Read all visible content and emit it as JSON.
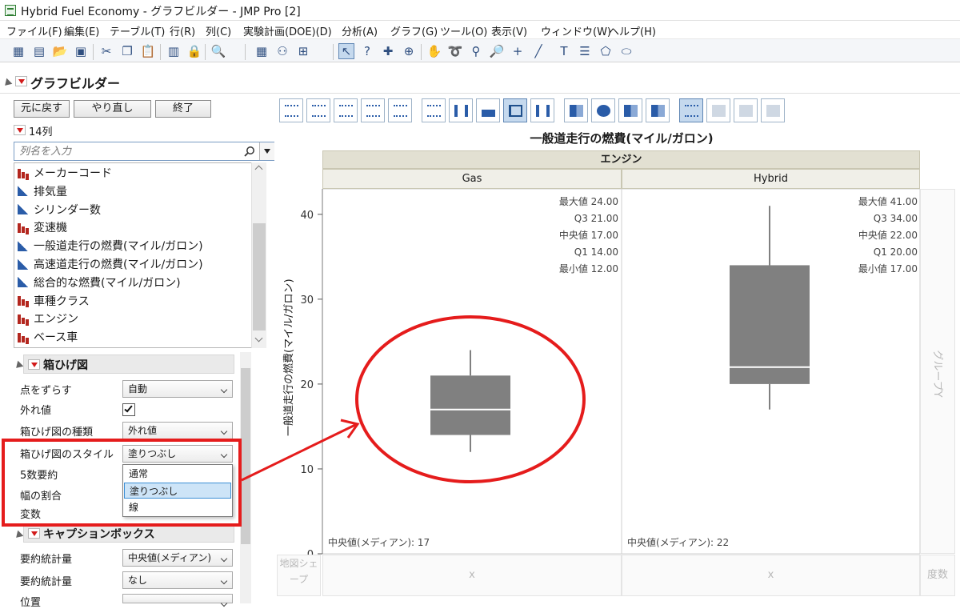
{
  "window": {
    "title": "Hybrid Fuel Economy - グラフビルダー - JMP Pro [2]"
  },
  "menu": [
    "ファイル(F)",
    "編集(E)",
    "テーブル(T)",
    "行(R)",
    "列(C)",
    "実験計画(DOE)(D)",
    "分析(A)",
    "グラフ(G)",
    "ツール(O)",
    "表示(V)",
    "ウィンドウ(W)",
    "ヘルプ(H)"
  ],
  "toolbar_icons": [
    "new-data-table-icon",
    "new-script-icon",
    "open-icon",
    "save-icon",
    "cut-icon",
    "copy-icon",
    "paste-icon",
    "journal-icon",
    "lock-icon",
    "search-icon",
    "data-grid-icon",
    "binoculars-icon",
    "add-column-icon",
    "arrow-tool-icon",
    "help-tool-icon",
    "selection-tool-icon",
    "crosshair-tool-icon",
    "grabber-tool-icon",
    "lasso-tool-icon",
    "brush-tool-icon",
    "zoom-tool-icon",
    "plus-tool-icon",
    "line-tool-icon",
    "annotate-tool-icon",
    "list-tool-icon",
    "polygon-tool-icon",
    "ellipse-tool-icon"
  ],
  "header": {
    "title": "グラフビルダー",
    "undo_label": "元に戻す",
    "redo_label": "やり直し",
    "done_label": "終了",
    "column_count": "14列",
    "search_placeholder": "列名を入力"
  },
  "columns": [
    {
      "name": "メーカーコード",
      "type": "nominal"
    },
    {
      "name": "排気量",
      "type": "continuous"
    },
    {
      "name": "シリンダー数",
      "type": "continuous"
    },
    {
      "name": "変速機",
      "type": "nominal"
    },
    {
      "name": "一般道走行の燃費(マイル/ガロン)",
      "type": "continuous"
    },
    {
      "name": "高速道走行の燃費(マイル/ガロン)",
      "type": "continuous"
    },
    {
      "name": "総合的な燃費(マイル/ガロン)",
      "type": "continuous"
    },
    {
      "name": "車種クラス",
      "type": "nominal"
    },
    {
      "name": "エンジン",
      "type": "nominal"
    },
    {
      "name": "ベース車",
      "type": "nominal"
    }
  ],
  "boxplot_section": {
    "title": "箱ひげ図",
    "jitter_label": "点をずらす",
    "jitter_value": "自動",
    "outliers_label": "外れ値",
    "outliers_checked": true,
    "box_type_label": "箱ひげ図の種類",
    "box_type_value": "外れ値",
    "box_style_label": "箱ひげ図のスタイル",
    "box_style_value": "塗りつぶし",
    "five_number_label": "5数要約",
    "width_ratio_label": "幅の割合",
    "variables_label": "変数",
    "style_options": [
      "通常",
      "塗りつぶし",
      "線"
    ],
    "style_selected_index": 1
  },
  "caption_section": {
    "title": "キャプションボックス",
    "summary_stat_label": "要約統計量",
    "summary_stat_value": "中央値(メディアン)",
    "summary_stat2_label": "要約統計量",
    "summary_stat2_value": "なし",
    "position_label": "位置"
  },
  "graph": {
    "title": "一般道走行の燃費(マイル/ガロン)",
    "group_x_label": "エンジン",
    "y_axis_label": "一般道走行の燃費(マイル/ガロン)",
    "group_y_label": "グループY",
    "map_shape_label": "地図シェープ",
    "freq_label": "度数",
    "x_zone_label": "x",
    "y_ticks": [
      "0",
      "10",
      "20",
      "30",
      "40"
    ]
  },
  "chart_data": {
    "type": "box",
    "title": "一般道走行の燃費(マイル/ガロン)",
    "ylabel": "一般道走行の燃費(マイル/ガロン)",
    "xlabel": "エンジン",
    "ylim": [
      0,
      43
    ],
    "groups": [
      {
        "name": "Gas",
        "max": 24,
        "q3": 21,
        "median": 17,
        "q1": 14,
        "min": 12,
        "stats": [
          [
            "最大値",
            "24.00"
          ],
          [
            "Q3",
            "21.00"
          ],
          [
            "中央値",
            "17.00"
          ],
          [
            "Q1",
            "14.00"
          ],
          [
            "最小値",
            "12.00"
          ]
        ],
        "caption": "中央値(メディアン): 17"
      },
      {
        "name": "Hybrid",
        "max": 41,
        "q3": 34,
        "median": 22,
        "q1": 20,
        "min": 17,
        "stats": [
          [
            "最大値",
            "41.00"
          ],
          [
            "Q3",
            "34.00"
          ],
          [
            "中央値",
            "22.00"
          ],
          [
            "Q1",
            "20.00"
          ],
          [
            "最小値",
            "17.00"
          ]
        ],
        "caption": "中央値(メディアン): 22"
      }
    ]
  },
  "colors": {
    "annotation_red": "#e51c1c",
    "box_fill": "#808080",
    "header_bar": "#e2e0d2",
    "selected_option": "#cde4f7"
  }
}
